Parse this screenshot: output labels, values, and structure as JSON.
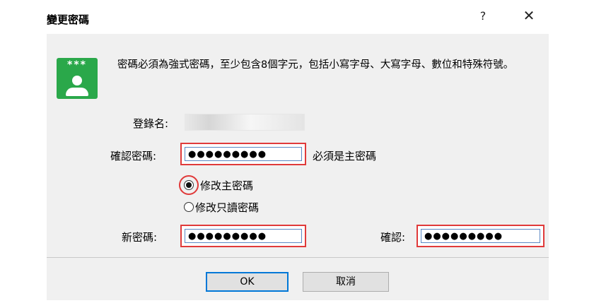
{
  "window": {
    "title": "變更密碼",
    "help_glyph": "?",
    "close_glyph": "✕"
  },
  "icon": {
    "stars": "***"
  },
  "description": "密碼必須為強式密碼，至少包含8個字元，包括小寫字母、大寫字母、數位和特殊符號。",
  "login": {
    "label": "登錄名:"
  },
  "confirm_password": {
    "label": "確認密碼:",
    "value": "●●●●●●●●●",
    "note": "必須是主密碼"
  },
  "mode": {
    "options": [
      {
        "label": "修改主密碼",
        "checked": true
      },
      {
        "label": "修改只讀密碼",
        "checked": false
      }
    ]
  },
  "new_password": {
    "label": "新密碼:",
    "value": "●●●●●●●●●"
  },
  "confirm": {
    "label": "確認:",
    "value": "●●●●●●●●●"
  },
  "buttons": {
    "ok": "OK",
    "cancel": "取消"
  },
  "colors": {
    "highlight": "#e03a3a",
    "icon_green": "#2aa84a",
    "focus_blue": "#0078d7"
  }
}
